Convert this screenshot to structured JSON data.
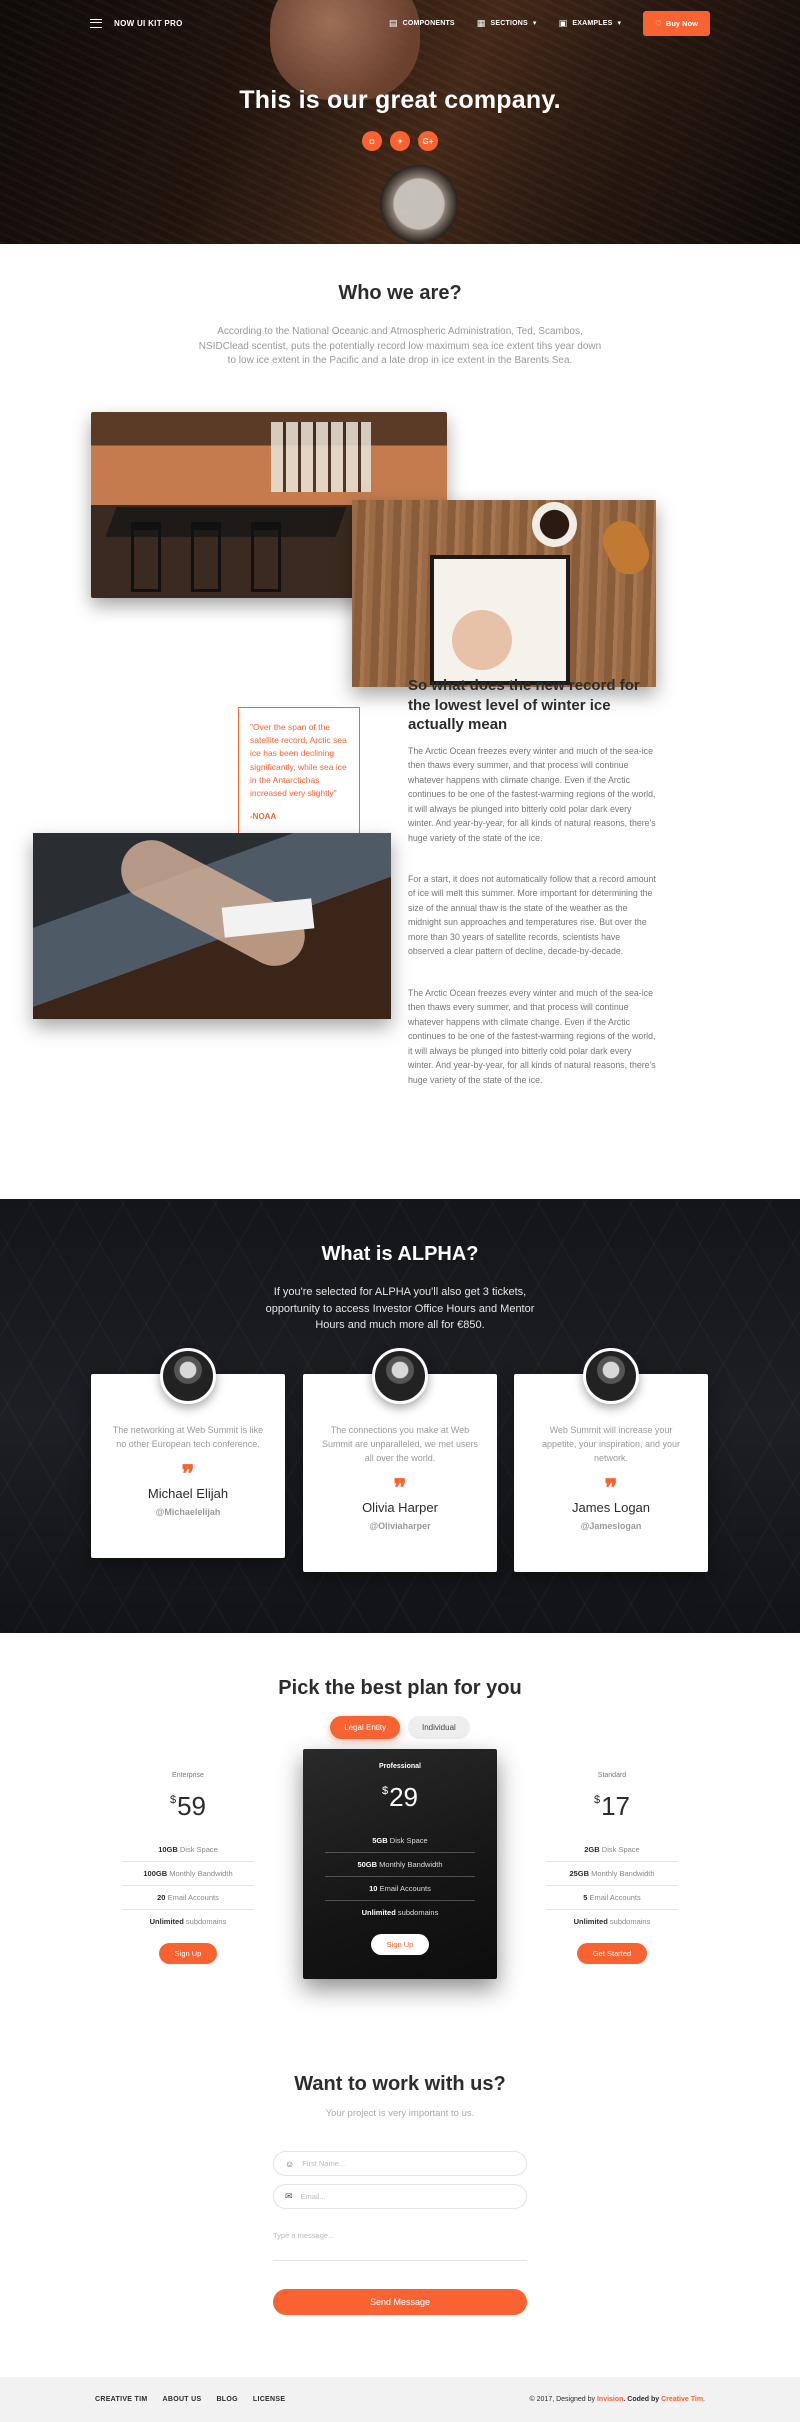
{
  "navbar": {
    "brand": "NOW UI KIT PRO",
    "links": [
      {
        "label": "COMPONENTS",
        "icon": "book-icon"
      },
      {
        "label": "SECTIONS",
        "icon": "sections-icon"
      },
      {
        "label": "EXAMPLES",
        "icon": "examples-icon"
      }
    ],
    "buy_label": "Buy Now"
  },
  "hero": {
    "title": "This is our great company.",
    "socials": [
      "instagram-icon",
      "twitter-icon",
      "google-plus-icon"
    ]
  },
  "about": {
    "title": "Who we are?",
    "description": "According to the National Oceanic and Atmospheric Administration, Ted, Scambos, NSIDClead scentist, puts the potentially record low maximum sea ice extent tihs year down to low ice extent in the Pacific and a late drop in ice extent in the Barents Sea.",
    "quote": "\"Over the span of the satellite record, Arctic sea ice has been declining significantly, while sea ice in the Antarctichas increased very slightly\"",
    "quote_author": "-NOAA",
    "heading": "So what does the new record for the lowest level of winter ice actually mean",
    "paragraphs": [
      "The Arctic Ocean freezes every winter and much of the sea-ice then thaws every summer, and that process will continue whatever happens with climate change. Even if the Arctic continues to be one of the fastest-warming regions of the world, it will always be plunged into bitterly cold polar dark every winter. And year-by-year, for all kinds of natural reasons, there's huge variety of the state of the ice.",
      "For a start, it does not automatically follow that a record amount of ice will melt this summer. More important for determining the size of the annual thaw is the state of the weather as the midnight sun approaches and temperatures rise. But over the more than 30 years of satellite records, scientists have observed a clear pattern of decline, decade-by-decade.",
      "The Arctic Ocean freezes every winter and much of the sea-ice then thaws every summer, and that process will continue whatever happens with climate change. Even if the Arctic continues to be one of the fastest-warming regions of the world, it will always be plunged into bitterly cold polar dark every winter. And year-by-year, for all kinds of natural reasons, there's huge variety of the state of the ice."
    ]
  },
  "alpha": {
    "title": "What is ALPHA?",
    "description": "If you're selected for ALPHA you'll also get 3 tickets, opportunity to access Investor Office Hours and Mentor Hours and much more all for €850.",
    "cards": [
      {
        "text": "The networking at Web Summit is like no other European tech conference.",
        "name": "Michael Elijah",
        "handle": "@Michaelelijah"
      },
      {
        "text": "The connections you make at Web Summit are unparalleled, we met users all over the world.",
        "name": "Olivia Harper",
        "handle": "@Oliviaharper"
      },
      {
        "text": "Web Summit will increase your appetite, your inspiration, and your network.",
        "name": "James Logan",
        "handle": "@Jameslogan"
      }
    ]
  },
  "pricing": {
    "title": "Pick the best plan for you",
    "toggle": [
      "Legal Entity",
      "Individual"
    ],
    "plans": [
      {
        "name": "Enterprise",
        "currency": "$",
        "price": "59",
        "features": [
          [
            "10GB",
            " Disk Space"
          ],
          [
            "100GB",
            " Monthly Bandwidth"
          ],
          [
            "20",
            " Email Accounts"
          ],
          [
            "Unlimited",
            " subdomains"
          ]
        ],
        "button": "Sign Up"
      },
      {
        "name": "Professional",
        "currency": "$",
        "price": "29",
        "features": [
          [
            "5GB",
            " Disk Space"
          ],
          [
            "50GB",
            " Monthly Bandwidth"
          ],
          [
            "10",
            " Email Accounts"
          ],
          [
            "Unlimited",
            " subdomains"
          ]
        ],
        "button": "Sign Up"
      },
      {
        "name": "Standard",
        "currency": "$",
        "price": "17",
        "features": [
          [
            "2GB",
            " Disk Space"
          ],
          [
            "25GB",
            " Monthly Bandwidth"
          ],
          [
            "5",
            " Email Accounts"
          ],
          [
            "Unlimited",
            " subdomains"
          ]
        ],
        "button": "Get Started"
      }
    ]
  },
  "contact": {
    "title": "Want to work with us?",
    "subtitle": "Your project is very important to us.",
    "name_placeholder": "First Name...",
    "email_placeholder": "Email...",
    "message_placeholder": "Type a message...",
    "send_label": "Send Message"
  },
  "footer": {
    "links": [
      "CREATIVE TIM",
      "ABOUT US",
      "BLOG",
      "LICENSE"
    ],
    "copy_prefix": "© 2017, Designed by ",
    "designer": "Invision",
    "copy_mid": ". Coded by ",
    "coder": "Creative Tim",
    "copy_suffix": "."
  },
  "colors": {
    "accent": "#f96332",
    "dark": "#2c2c2c"
  }
}
